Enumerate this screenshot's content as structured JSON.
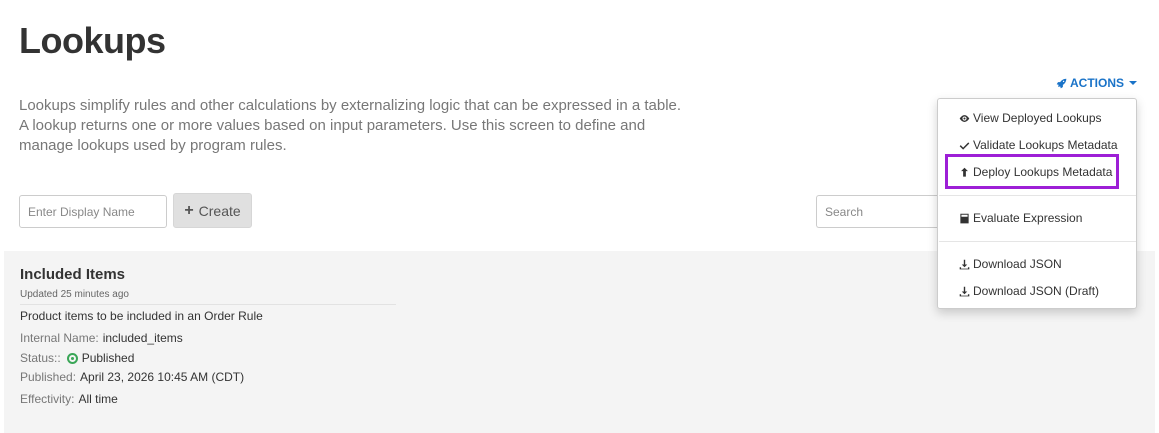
{
  "page": {
    "title": "Lookups",
    "description": "Lookups simplify rules and other calculations by externalizing logic that can be expressed in a table. A lookup returns one or more values based on input parameters. Use this screen to define and manage lookups used by program rules."
  },
  "actions": {
    "label": "ACTIONS",
    "icon": "rocket-icon",
    "menu": {
      "items": [
        {
          "label": "View Deployed Lookups",
          "icon": "eye-icon"
        },
        {
          "label": "Validate Lookups Metadata",
          "icon": "check-icon"
        },
        {
          "label": "Deploy Lookups Metadata",
          "icon": "upload-arrow-icon",
          "highlighted": true
        },
        {
          "label": "Evaluate Expression",
          "icon": "calculator-icon"
        },
        {
          "label": "Download JSON",
          "icon": "download-icon"
        },
        {
          "label": "Download JSON (Draft)",
          "icon": "download-icon"
        }
      ]
    }
  },
  "toolbar": {
    "display_name_placeholder": "Enter Display Name",
    "create_label": "Create",
    "search_placeholder": "Search"
  },
  "item": {
    "title": "Included Items",
    "updated": "Updated 25 minutes ago",
    "description": "Product items to be included in an Order Rule",
    "internal_name_label": "Internal Name:",
    "internal_name": "included_items",
    "status_label": "Status::",
    "status": "Published",
    "published_label": "Published:",
    "published": "April 23, 2026 10:45 AM (CDT)",
    "effectivity_label": "Effectivity:",
    "effectivity": "All time"
  },
  "colors": {
    "accent": "#1a73c8",
    "highlight": "#9d1fd6",
    "status_published": "#3aa657"
  }
}
